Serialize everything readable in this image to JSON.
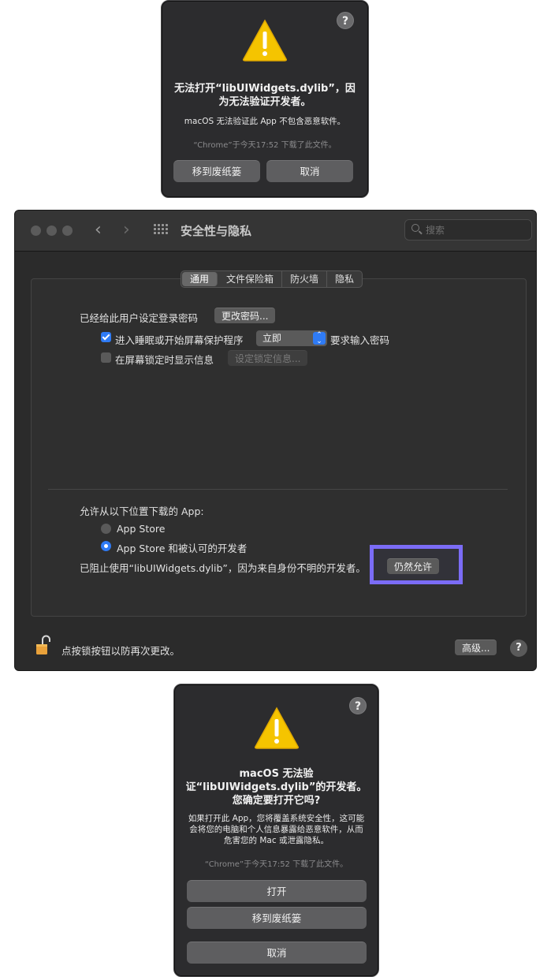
{
  "alert_top": {
    "help": "?",
    "title": "无法打开“libUIWidgets.dylib”，因为无法验证开发者。",
    "message": "macOS 无法验证此 App 不包含恶意软件。",
    "source": "“Chrome”于今天17:52 下载了此文件。",
    "buttons": {
      "trash": "移到废纸篓",
      "cancel": "取消"
    }
  },
  "prefs": {
    "title": "安全性与隐私",
    "search_placeholder": "搜索",
    "tabs": [
      "通用",
      "文件保险箱",
      "防火墙",
      "隐私"
    ],
    "active_tab": "通用",
    "login_password_label": "已经给此用户设定登录密码",
    "change_password_button": "更改密码...",
    "require_password_label": "进入睡眠或开始屏幕保护程序",
    "require_password_checked": true,
    "require_password_select": "立即",
    "require_password_suffix": "要求输入密码",
    "show_message_label": "在屏幕锁定时显示信息",
    "show_message_checked": false,
    "set_lock_message_button": "设定锁定信息...",
    "allow_apps_label": "允许从以下位置下载的 App:",
    "radio_app_store": "App Store",
    "radio_app_store_dev": "App Store 和被认可的开发者",
    "selected_source": "App Store 和被认可的开发者",
    "blocked_text": "已阻止使用“libUIWidgets.dylib”，因为来自身份不明的开发者。",
    "allow_anyway_button": "仍然允许",
    "lock_text": "点按锁按钮以防再次更改。",
    "advanced_button": "高级...",
    "help": "?"
  },
  "alert_bottom": {
    "help": "?",
    "title": "macOS 无法验证“libUIWidgets.dylib”的开发者。您确定要打开它吗?",
    "message": "如果打开此 App，您将覆盖系统安全性，这可能会将您的电脑和个人信息暴露给恶意软件，从而危害您的 Mac 或泄露隐私。",
    "source": "“Chrome”于今天17:52 下载了此文件。",
    "buttons": {
      "open": "打开",
      "trash": "移到废纸篓",
      "cancel": "取消"
    }
  },
  "colors": {
    "accent": "#2f7bf5",
    "highlight": "#7b6cf6",
    "warning": "#f5c400"
  }
}
